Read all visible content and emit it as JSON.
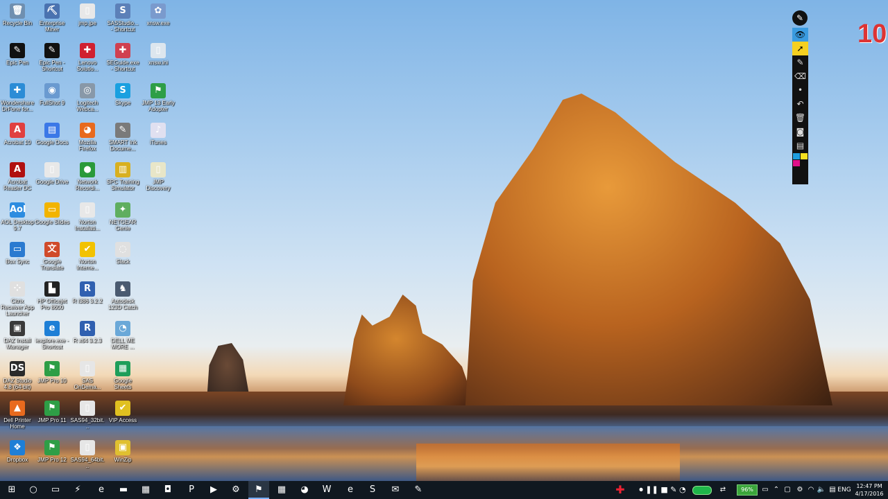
{
  "desktop_icons": [
    {
      "label": "Recycle Bin",
      "glyph": "🗑",
      "color": "#6f8fb0"
    },
    {
      "label": "Enterprise Miner",
      "glyph": "⛏",
      "color": "#4a72b0"
    },
    {
      "label": "jmp.jpe",
      "glyph": "▯",
      "color": "#e8e8e8"
    },
    {
      "label": "SASStudio... - Shortcut",
      "glyph": "S",
      "color": "#5c80b8"
    },
    {
      "label": "xnsw.exe",
      "glyph": "✿",
      "color": "#7a9acd"
    },
    {
      "label": "Epic Pen",
      "glyph": "✎",
      "color": "#111111"
    },
    {
      "label": "Epic Pen - Shortcut",
      "glyph": "✎",
      "color": "#111111"
    },
    {
      "label": "Lenovo Solutio...",
      "glyph": "✚",
      "color": "#d02030"
    },
    {
      "label": "SEGuide.exe - Shortcut",
      "glyph": "✚",
      "color": "#d04050"
    },
    {
      "label": "xnsw.ini",
      "glyph": "▯",
      "color": "#dde6ee"
    },
    {
      "label": "Wondershare DrFone for...",
      "glyph": "✚",
      "color": "#2b8cd6"
    },
    {
      "label": "FullShot 9",
      "glyph": "◉",
      "color": "#6a9ad0"
    },
    {
      "label": "Logitech Webca...",
      "glyph": "◎",
      "color": "#8898a8"
    },
    {
      "label": "Skype",
      "glyph": "S",
      "color": "#1aa0e0"
    },
    {
      "label": "JMP 13 Early Adopter",
      "glyph": "⚑",
      "color": "#2e9e46"
    },
    {
      "label": "Acrobat 10",
      "glyph": "A",
      "color": "#e04040"
    },
    {
      "label": "Google Docs",
      "glyph": "▤",
      "color": "#3b78e7"
    },
    {
      "label": "Mozilla Firefox",
      "glyph": "◕",
      "color": "#e86a1e"
    },
    {
      "label": "SMART Ink Docume...",
      "glyph": "✎",
      "color": "#7a7a7a"
    },
    {
      "label": "iTunes",
      "glyph": "♪",
      "color": "#e0e0f0"
    },
    {
      "label": "Acrobat Reader DC",
      "glyph": "A",
      "color": "#b01010"
    },
    {
      "label": "Google Drive",
      "glyph": "▯",
      "color": "#e8e8e8"
    },
    {
      "label": "Network Recordi...",
      "glyph": "●",
      "color": "#2a9a3a"
    },
    {
      "label": "SPC Training Simulator",
      "glyph": "▥",
      "color": "#d8b020"
    },
    {
      "label": "JMP Discovery",
      "glyph": "▯",
      "color": "#e8e6c8"
    },
    {
      "label": "AOL Desktop 9.7",
      "glyph": "Aol",
      "color": "#2d8ce0"
    },
    {
      "label": "Google Slides",
      "glyph": "▭",
      "color": "#f2b400"
    },
    {
      "label": "Norton Installati...",
      "glyph": "▯",
      "color": "#e8e8e8"
    },
    {
      "label": "NETGEAR Genie",
      "glyph": "✦",
      "color": "#5fae5f"
    },
    {
      "label": "",
      "glyph": "",
      "color": "transparent"
    },
    {
      "label": "Box Sync",
      "glyph": "▭",
      "color": "#2a7ad0"
    },
    {
      "label": "Google Translate",
      "glyph": "文",
      "color": "#d04a2a"
    },
    {
      "label": "Norton Interne...",
      "glyph": "✔",
      "color": "#f2c200"
    },
    {
      "label": "Slack",
      "glyph": "◌",
      "color": "#e0e0e0"
    },
    {
      "label": "",
      "glyph": "",
      "color": "transparent"
    },
    {
      "label": "Citrix Receiver App Launcher",
      "glyph": "⁘",
      "color": "#e0e0e0"
    },
    {
      "label": "HP Officejet Pro 8600",
      "glyph": "▙",
      "color": "#222222"
    },
    {
      "label": "R i386 3.2.2",
      "glyph": "R",
      "color": "#3060b0"
    },
    {
      "label": "Autodesk 123D Catch",
      "glyph": "♞",
      "color": "#4a5a70"
    },
    {
      "label": "",
      "glyph": "",
      "color": "transparent"
    },
    {
      "label": "DAZ Install Manager",
      "glyph": "▣",
      "color": "#3a3a3a"
    },
    {
      "label": "iexplore.exe - Shortcut",
      "glyph": "e",
      "color": "#1e7fd6"
    },
    {
      "label": "R x64 3.2.3",
      "glyph": "R",
      "color": "#3060b0"
    },
    {
      "label": "DELL ME MORE ...",
      "glyph": "◔",
      "color": "#6aa8d8"
    },
    {
      "label": "",
      "glyph": "",
      "color": "transparent"
    },
    {
      "label": "DAZ Studio 4.8 (64-bit)",
      "glyph": "DS",
      "color": "#2a2a2a"
    },
    {
      "label": "JMP Pro 10",
      "glyph": "⚑",
      "color": "#2e9e46"
    },
    {
      "label": "SAS OnDema...",
      "glyph": "▯",
      "color": "#e6e6e6"
    },
    {
      "label": "Google Sheets",
      "glyph": "▦",
      "color": "#1e9e5a"
    },
    {
      "label": "",
      "glyph": "",
      "color": "transparent"
    },
    {
      "label": "Dell Printer Home",
      "glyph": "▲",
      "color": "#e86a1e"
    },
    {
      "label": "JMP Pro 11",
      "glyph": "⚑",
      "color": "#2e9e46"
    },
    {
      "label": "SAS94_32bit...",
      "glyph": "▯",
      "color": "#e6e6e6"
    },
    {
      "label": "VIP Access",
      "glyph": "✔",
      "color": "#e0c020"
    },
    {
      "label": "",
      "glyph": "",
      "color": "transparent"
    },
    {
      "label": "Dropbox",
      "glyph": "❖",
      "color": "#1e7fd6"
    },
    {
      "label": "JMP Pro 12",
      "glyph": "⚑",
      "color": "#2e9e46"
    },
    {
      "label": "SAS94_64bit...",
      "glyph": "▯",
      "color": "#e6e6e6"
    },
    {
      "label": "WinZip",
      "glyph": "▣",
      "color": "#e0c030"
    }
  ],
  "pen_toolbar": {
    "logo_icon": "pen-tip-icon",
    "tools": [
      {
        "name": "eye-icon",
        "glyph": "👁"
      },
      {
        "name": "cursor-icon",
        "glyph": "➚"
      },
      {
        "name": "pen-icon",
        "glyph": "✎"
      },
      {
        "name": "highlighter-icon",
        "glyph": "⌫"
      },
      {
        "name": "dot-icon",
        "glyph": "•"
      },
      {
        "name": "undo-icon",
        "glyph": "↶"
      },
      {
        "name": "trash-icon",
        "glyph": "🗑"
      },
      {
        "name": "camera-icon",
        "glyph": "◙"
      },
      {
        "name": "board-icon",
        "glyph": "▤"
      }
    ],
    "swatches": [
      "#1e9ee0",
      "#f5e020",
      "#e0108a",
      "#111111"
    ]
  },
  "counter": "10",
  "taskbar": {
    "buttons": [
      {
        "name": "start-button",
        "glyph": "⊞"
      },
      {
        "name": "search-button",
        "glyph": "○"
      },
      {
        "name": "task-view-button",
        "glyph": "▭"
      },
      {
        "name": "fast-typing-icon",
        "glyph": "⚡"
      },
      {
        "name": "edge-taskbar-icon",
        "glyph": "e"
      },
      {
        "name": "file-explorer-taskbar-icon",
        "glyph": "▬"
      },
      {
        "name": "store-taskbar-icon",
        "glyph": "▦"
      },
      {
        "name": "sticky-taskbar-icon",
        "glyph": "◘"
      },
      {
        "name": "powerpoint-taskbar-icon",
        "glyph": "P"
      },
      {
        "name": "media-taskbar-icon",
        "glyph": "▶"
      },
      {
        "name": "settings-taskbar-icon",
        "glyph": "⚙"
      },
      {
        "name": "jmp-taskbar-icon",
        "glyph": "⚑"
      },
      {
        "name": "calculator-taskbar-icon",
        "glyph": "▦"
      },
      {
        "name": "firefox-taskbar-icon",
        "glyph": "◕"
      },
      {
        "name": "word-taskbar-icon",
        "glyph": "W"
      },
      {
        "name": "ie-taskbar-icon",
        "glyph": "e"
      },
      {
        "name": "skype-taskbar-icon",
        "glyph": "S"
      },
      {
        "name": "mail-taskbar-icon",
        "glyph": "✉"
      },
      {
        "name": "epic-pen-taskbar-icon",
        "glyph": "✎"
      }
    ],
    "battery": "96%",
    "language": "ENG",
    "time": "12:47 PM",
    "date": "4/17/2016"
  }
}
